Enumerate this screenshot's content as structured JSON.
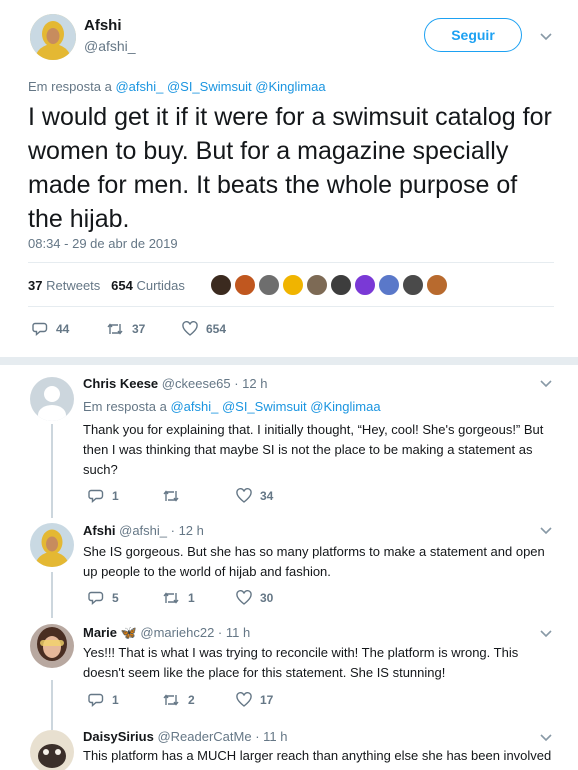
{
  "main_tweet": {
    "author_name": "Afshi",
    "author_handle": "@afshi_",
    "follow_label": "Seguir",
    "reply_prefix": "Em resposta a",
    "reply_mentions": "@afshi_ @SI_Swimsuit @Kinglimaa",
    "text": "I would get it if it were for a swimsuit catalog for women to buy. But for a magazine specially made for men.  It beats the whole purpose of the hijab.",
    "timestamp": "08:34 - 29 de abr de 2019",
    "retweets_count": "37",
    "retweets_label": "Retweets",
    "likes_count": "654",
    "likes_label": "Curtidas",
    "actions": {
      "reply": "44",
      "retweet": "37",
      "like": "654"
    }
  },
  "replies": [
    {
      "name": "Chris Keese",
      "meta": "@ckeese65 · 12 h",
      "reply_prefix": "Em resposta a",
      "reply_mentions": "@afshi_ @SI_Swimsuit @Kinglimaa",
      "text": "Thank you for explaining that.  I initially thought, “Hey, cool!  She's gorgeous!” But then I was thinking that maybe SI is not the place to be making a statement as such?",
      "actions": {
        "reply": "1",
        "retweet": "",
        "like": "34"
      }
    },
    {
      "name": "Afshi",
      "meta": "@afshi_ · 12 h",
      "text": "She IS gorgeous. But she has so many platforms to make a statement and open up people to the world of hijab and fashion.",
      "actions": {
        "reply": "5",
        "retweet": "1",
        "like": "30"
      }
    },
    {
      "name": "Marie",
      "meta": "@mariehc22 · 11 h",
      "text": "Yes!!! That is what I was trying to reconcile with! The platform is wrong. This doesn't seem like the place for this statement. She IS stunning!",
      "actions": {
        "reply": "1",
        "retweet": "2",
        "like": "17"
      }
    },
    {
      "name": "DaisySirius",
      "meta": "@ReaderCatMe · 11 h",
      "text": "This platform has a MUCH larger reach than anything else she has been involved in. And the novelty got it into my twitter feed and will get the attention"
    }
  ],
  "colors": {
    "accent": "#1da1f2",
    "mention": "#1b95e0",
    "muted": "#657786"
  }
}
